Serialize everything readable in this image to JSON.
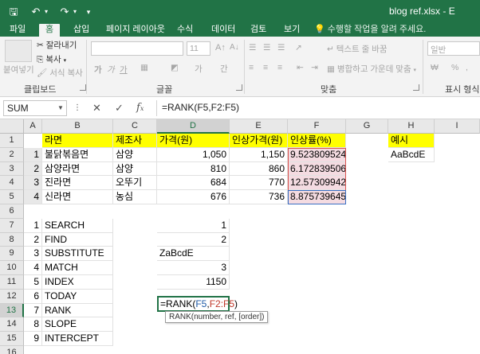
{
  "window": {
    "document_title": "blog ref.xlsx - E"
  },
  "tabs": [
    "파일",
    "홈",
    "삽입",
    "페이지 레이아웃",
    "수식",
    "데이터",
    "검토",
    "보기"
  ],
  "active_tab": "홈",
  "tell_me": "수행할 작업을 알려 주세요.",
  "ribbon": {
    "paste": "붙여넣기",
    "cut": "잘라내기",
    "copy": "복사",
    "format_painter": "서식 복사",
    "font_size": "11",
    "wrap_text": "텍스트 줄 바꿈",
    "merge_center": "병합하고 가운데 맞춤",
    "number_format": "일반",
    "groups": [
      "클립보드",
      "글꼴",
      "맞춤",
      "표시 형식"
    ]
  },
  "formula_bar": {
    "name_box": "SUM",
    "formula": "=RANK(F5,F2:F5)"
  },
  "columns": [
    "A",
    "B",
    "C",
    "D",
    "E",
    "F",
    "G",
    "H",
    "I"
  ],
  "selected_column": "D",
  "selected_row": "13",
  "rows": [
    "1",
    "2",
    "3",
    "4",
    "5",
    "6",
    "7",
    "8",
    "9",
    "10",
    "11",
    "12",
    "13",
    "14",
    "15",
    "16"
  ],
  "table": {
    "headers": [
      "라면",
      "제조사",
      "가격(원)",
      "인상가격(원)",
      "인상률(%)"
    ],
    "rows": [
      {
        "idx": "1",
        "name": "불닭볶음면",
        "maker": "삼양",
        "price": "1,050",
        "new_price": "1,150",
        "rate": "9.523809524"
      },
      {
        "idx": "2",
        "name": "삼양라면",
        "maker": "삼양",
        "price": "810",
        "new_price": "860",
        "rate": "6.172839506"
      },
      {
        "idx": "3",
        "name": "진라면",
        "maker": "오뚜기",
        "price": "684",
        "new_price": "770",
        "rate": "12.57309942"
      },
      {
        "idx": "4",
        "name": "신라면",
        "maker": "농심",
        "price": "676",
        "new_price": "736",
        "rate": "8.875739645"
      }
    ]
  },
  "example": {
    "header": "예시",
    "value": "AaBcdE"
  },
  "functions": [
    {
      "idx": "1",
      "name": "SEARCH",
      "result": "1"
    },
    {
      "idx": "2",
      "name": "FIND",
      "result": "2"
    },
    {
      "idx": "3",
      "name": "SUBSTITUTE",
      "result": "ZaBcdE"
    },
    {
      "idx": "4",
      "name": "MATCH",
      "result": "3"
    },
    {
      "idx": "5",
      "name": "INDEX",
      "result": "1150"
    },
    {
      "idx": "6",
      "name": "TODAY",
      "result": ""
    },
    {
      "idx": "7",
      "name": "RANK",
      "result": ""
    },
    {
      "idx": "8",
      "name": "SLOPE",
      "result": ""
    },
    {
      "idx": "9",
      "name": "INTERCEPT",
      "result": ""
    }
  ],
  "editing": {
    "prefix": "=RANK(",
    "ref1": "F5",
    "comma": ",",
    "ref2": "F2:F5",
    "suffix": ")"
  },
  "tooltip": {
    "text": "RANK(number, ref, [order])"
  }
}
